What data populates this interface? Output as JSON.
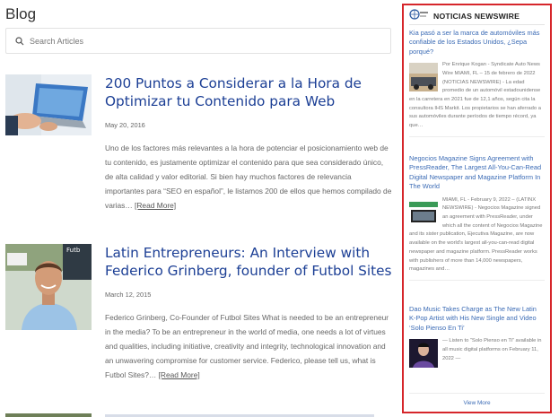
{
  "page": {
    "title": "Blog"
  },
  "search": {
    "placeholder": "Search Articles"
  },
  "posts": [
    {
      "title": "200 Puntos a Considerar a la Hora de Optimizar tu Contenido para Web",
      "date": "May 20, 2016",
      "excerpt": "Uno de los factores más relevantes a la hora de potenciar el posicionamiento web de tu contenido, es justamente optimizar el contenido para que sea considerado único, de alta calidad y valor editorial. Si bien hay muchos factores de relevancia importantes para “SEO en español”, le listamos 200 de ellos que hemos compilado de varias…",
      "more": "[Read More]"
    },
    {
      "title": "Latin Entrepreneurs: An Interview with Federico Grinberg, founder of Futbol Sites",
      "date": "March 12, 2015",
      "excerpt": "Federico Grinberg, Co-Founder of Futbol Sites What is needed to be an entrepreneur in the media? To be an entrepreneur in the world of media, one needs a lot of virtues and qualities, including initiative, creativity and integrity, technological innovation and an unwavering compromise for customer service. Federico, please tell us, what is Futbol Sites?…",
      "more": "[Read More]"
    }
  ],
  "widget": {
    "title": "NOTICIAS NEWSWIRE",
    "items": [
      {
        "headline": "Kia pasó a ser la marca de automóviles más confiable de los Estados Unidos, ¿Sepa porqué?",
        "text": "Por Enrique Kogan - Syndicate Auto News Wire MIAMI, FL – 15 de febrero de 2022 (NOTICIAS NEWSWIRE) - La edad promedio de un automóvil estadounidense en la carretera en 2021 fue de 12,1 años, según cita la consultora IHS Markit. Los propietarios se han aferrado a sus automóviles durante períodos de tiempo récord, ya que…"
      },
      {
        "headline": "Negocios Magazine Signs Agreement with PressReader, The Largest All-You-Can-Read Digital Newspaper and Magazine Platform In The World",
        "text": "MIAMI, FL - February 9, 2022 – (LATINX NEWSWIRE) - Negocios Magazine signed an agreement with PressReader, under which all the content of Negocios Magazine and its sister publication, Ejecutiva Magazine, are now available on the world's largest all-you-can-read digital newspaper and magazine platform. PressReader works with publishers of more than 14,000 newspapers, magazines and…"
      },
      {
        "headline": "Dao Music Takes Charge as The New Latin K-Pop Artist with His New Single and Video ‘Solo Pienso En Ti’",
        "text": "— Listen to “Solo Pienso en Ti” available in all music digital platforms on February 11, 2022 —"
      }
    ],
    "view_more": "View More"
  },
  "colors": {
    "accent_blue": "#1c3f95",
    "link_blue": "#3b6bb5",
    "widget_border": "#d6262b"
  }
}
